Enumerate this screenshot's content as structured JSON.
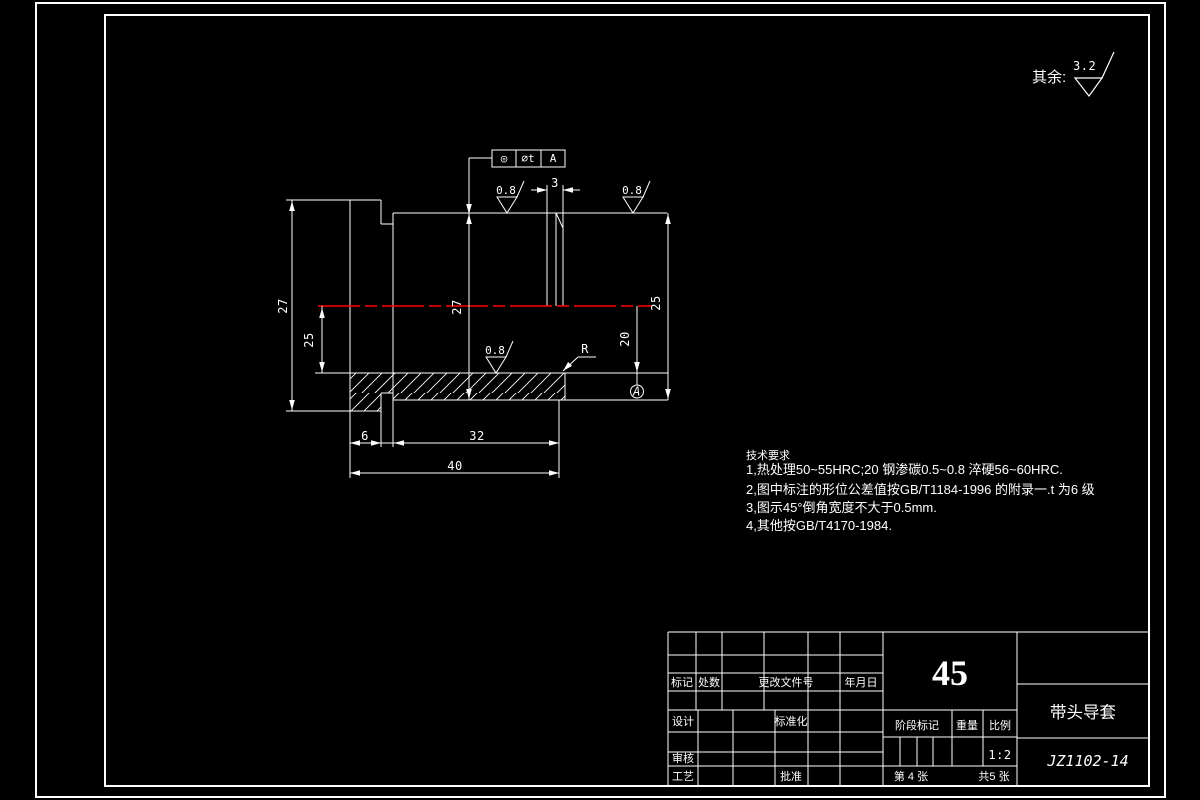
{
  "drawing": {
    "general_roughness": {
      "label": "其余:",
      "value": "3.2"
    },
    "fcf": {
      "tol_symbol": "◎",
      "tol_value": "⌀t",
      "datum": "A"
    },
    "roughness_value": "0.8",
    "dims": {
      "head_od": "27",
      "bore_left": "25",
      "body_27": "27",
      "body_od": "25",
      "bore_20": "20",
      "head_width": "6",
      "body_length": "32",
      "total_length": "40",
      "groove_width": "3"
    },
    "labels": {
      "radius": "R",
      "datum": "A"
    }
  },
  "tech": {
    "title": "技术要求",
    "lines": [
      "1,热处理50~55HRC;20 钢渗碳0.5~0.8 淬硬56~60HRC.",
      "2,图中标注的形位公差值按GB/T1184-1996 的附录一.t 为6 级",
      "3,图示45°倒角宽度不大于0.5mm.",
      "4,其他按GB/T4170-1984."
    ]
  },
  "title_block": {
    "rev": {
      "mark": "标记",
      "count": "处数",
      "doc_no": "更改文件号",
      "date": "年月日"
    },
    "sign": {
      "design": "设计",
      "standard": "标准化",
      "audit": "审核",
      "process": "工艺",
      "approve": "批准"
    },
    "material": "45",
    "stage_label": "阶段标记",
    "weight_label": "重量",
    "scale_label": "比例",
    "scale_value": "1:2",
    "sheet": "第 4 张",
    "sheets_total": "共5 张",
    "part_name": "带头导套",
    "drawing_no": "JZ1102-14"
  }
}
